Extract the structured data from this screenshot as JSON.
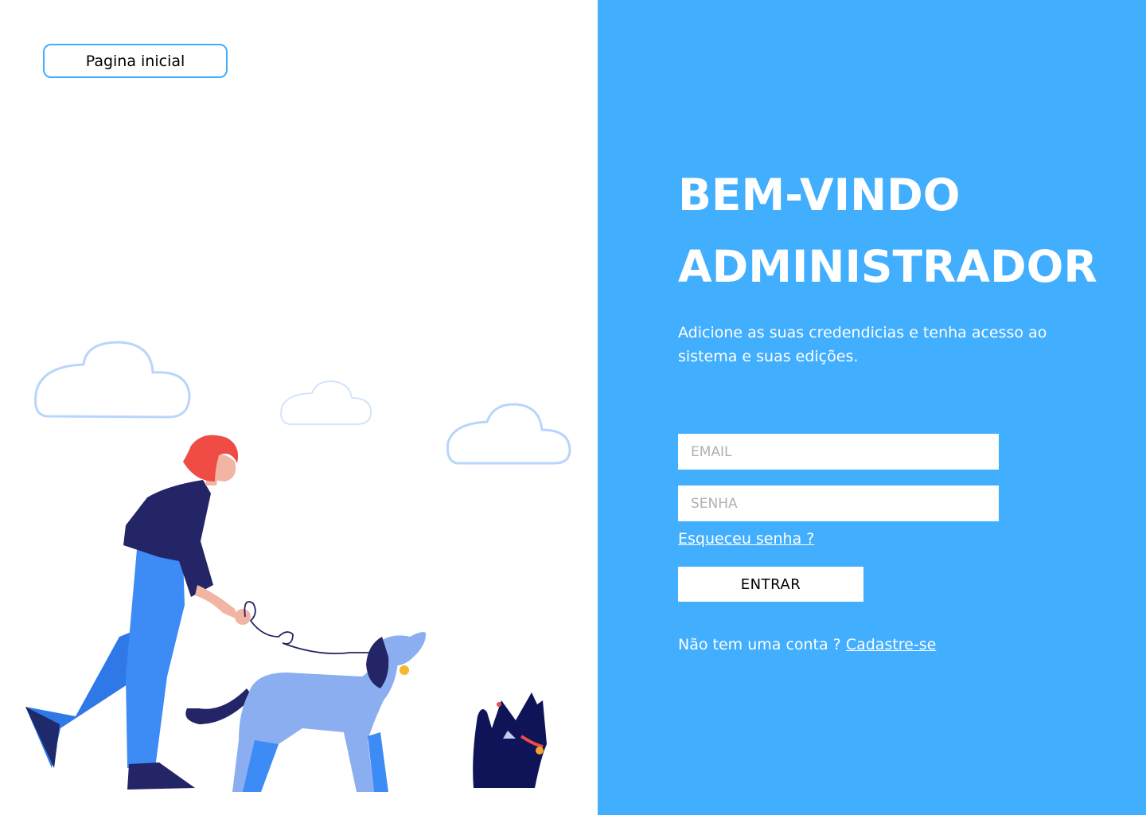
{
  "colors": {
    "accent": "#42aefe",
    "white": "#ffffff",
    "placeholder": "#b0b0b0"
  },
  "left": {
    "home_button_label": "Pagina inicial",
    "illustration": "woman-walking-dogs-illustration"
  },
  "right": {
    "title_line1": "BEM-VINDO",
    "title_line2": "ADMINISTRADOR",
    "subtitle": "Adicione as suas credendicias e tenha acesso ao sistema e suas edições.",
    "email_placeholder": "EMAIL",
    "password_placeholder": "SENHA",
    "forgot_label": "Esqueceu senha ?",
    "submit_label": "ENTRAR",
    "signup_prompt": "Não tem uma conta ?",
    "signup_link": "Cadastre-se"
  }
}
